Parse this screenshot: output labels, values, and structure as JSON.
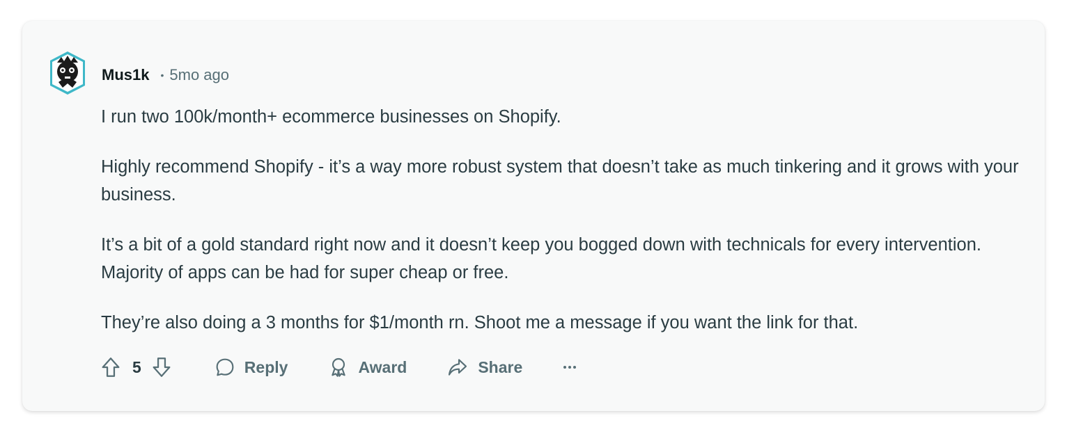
{
  "comment": {
    "author": "Mus1k",
    "separator": "•",
    "time_ago": "5mo ago",
    "paragraphs": [
      "I run two 100k/month+ ecommerce businesses on Shopify.",
      "Highly recommend Shopify - it’s a way more robust system that doesn’t take as much tinkering and it grows with your business.",
      "It’s a bit of a gold standard right now and it doesn’t keep you bogged down with technicals for every intervention. Majority of apps can be had for super cheap or free.",
      "They’re also doing a 3 months for $1/month rn. Shoot me a message if you want the link for that."
    ]
  },
  "actions": {
    "vote_count": "5",
    "reply_label": "Reply",
    "award_label": "Award",
    "share_label": "Share",
    "more_label": "···"
  },
  "icons": {
    "upvote": "arrow-up-icon",
    "downvote": "arrow-down-icon",
    "reply": "speech-bubble-icon",
    "award": "award-ribbon-icon",
    "share": "share-arrow-icon",
    "more": "ellipsis-icon"
  },
  "colors": {
    "card_background": "#f8f9f9",
    "text_primary": "#0f1a1c",
    "text_body": "#2a3c42",
    "text_muted": "#576f76",
    "avatar_accent": "#3fb8c8"
  }
}
